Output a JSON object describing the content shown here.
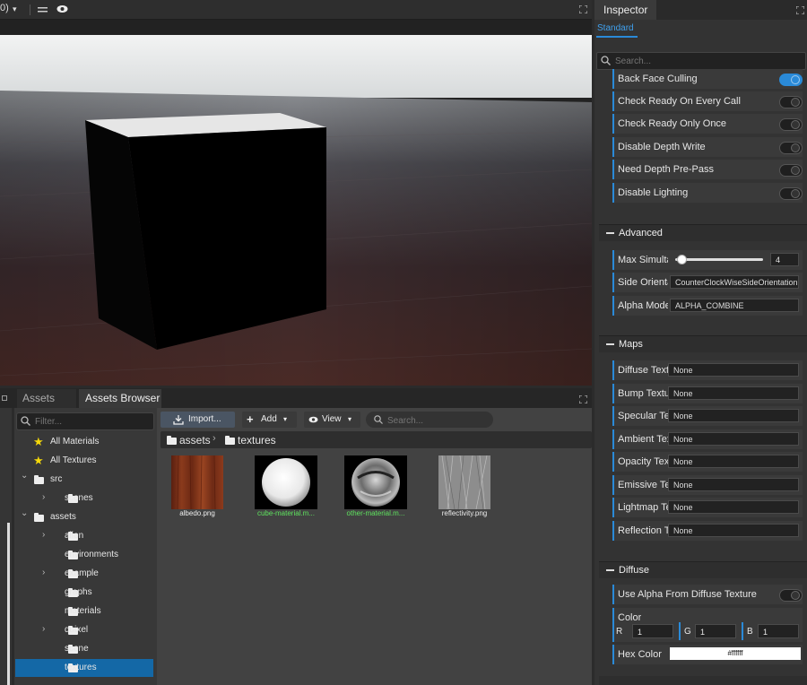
{
  "viewport": {
    "toolbar_left_text": "0)",
    "toolbar_caret": "▾"
  },
  "inspector": {
    "title": "Inspector",
    "tab": "Standard",
    "search_placeholder": "Search...",
    "toggles": [
      {
        "label": "Back Face Culling",
        "on": true
      },
      {
        "label": "Check Ready On Every Call",
        "on": false
      },
      {
        "label": "Check Ready Only Once",
        "on": false
      },
      {
        "label": "Disable Depth Write",
        "on": false
      },
      {
        "label": "Need Depth Pre-Pass",
        "on": false
      },
      {
        "label": "Disable Lighting",
        "on": false
      }
    ],
    "advanced": {
      "title": "Advanced",
      "max_simultaneous_label": "Max Simultar",
      "max_simultaneous_value": "4",
      "max_simultaneous_fraction": 0.08,
      "side_orientation_label": "Side Orientat",
      "side_orientation_value": "CounterClockWiseSideOrientation",
      "alpha_mode_label": "Alpha Mode",
      "alpha_mode_value": "ALPHA_COMBINE"
    },
    "maps": {
      "title": "Maps",
      "items": [
        {
          "label": "Diffuse Textu",
          "value": "None"
        },
        {
          "label": "Bump Textur",
          "value": "None"
        },
        {
          "label": "Specular Tex",
          "value": "None"
        },
        {
          "label": "Ambient Text",
          "value": "None"
        },
        {
          "label": "Opacity Textu",
          "value": "None"
        },
        {
          "label": "Emissive Tex",
          "value": "None"
        },
        {
          "label": "Lightmap Te",
          "value": "None"
        },
        {
          "label": "Reflection Te",
          "value": "None"
        }
      ]
    },
    "diffuse": {
      "title": "Diffuse",
      "use_alpha_label": "Use Alpha From Diffuse Texture",
      "color_label": "Color",
      "r_label": "R",
      "r_value": "1",
      "g_label": "G",
      "g_value": "1",
      "b_label": "B",
      "b_value": "1",
      "hex_label": "Hex Color",
      "hex_value": "#ffffff"
    }
  },
  "bottom": {
    "tabs": [
      "Assets",
      "Assets Browser"
    ],
    "filter_placeholder": "Filter...",
    "tree": [
      {
        "label": "All Materials",
        "icon": "star",
        "indent": 0
      },
      {
        "label": "All Textures",
        "icon": "star",
        "indent": 0
      },
      {
        "label": "src",
        "icon": "folder",
        "indent": 0,
        "expanded": true
      },
      {
        "label": "scenes",
        "icon": "folder",
        "indent": 1,
        "collapsed": true
      },
      {
        "label": "assets",
        "icon": "folder",
        "indent": 0,
        "expanded": true
      },
      {
        "label": "alien",
        "icon": "folder",
        "indent": 1,
        "collapsed": true
      },
      {
        "label": "environments",
        "icon": "folder",
        "indent": 1
      },
      {
        "label": "example",
        "icon": "folder",
        "indent": 1,
        "collapsed": true
      },
      {
        "label": "graphs",
        "icon": "folder",
        "indent": 1
      },
      {
        "label": "materials",
        "icon": "folder",
        "indent": 1
      },
      {
        "label": "quixel",
        "icon": "folder",
        "indent": 1,
        "collapsed": true
      },
      {
        "label": "scene",
        "icon": "folder",
        "indent": 1
      },
      {
        "label": "textures",
        "icon": "folder",
        "indent": 1,
        "selected": true
      }
    ],
    "toolbar": {
      "import": "Import...",
      "add": "Add",
      "view": "View",
      "search_placeholder": "Search..."
    },
    "breadcrumb": [
      "assets",
      "textures"
    ],
    "files": [
      {
        "name": "albedo.png",
        "kind": "wood"
      },
      {
        "name": "cube-material.m...",
        "kind": "sphere-white",
        "highlight": true
      },
      {
        "name": "other-material.m...",
        "kind": "sphere-chrome",
        "highlight": true
      },
      {
        "name": "reflectivity.png",
        "kind": "noise"
      }
    ]
  },
  "colors": {
    "accent": "#2a8ad8",
    "selected": "#1468a6",
    "material_name": "#5fe35f",
    "star": "#f5d90a"
  }
}
